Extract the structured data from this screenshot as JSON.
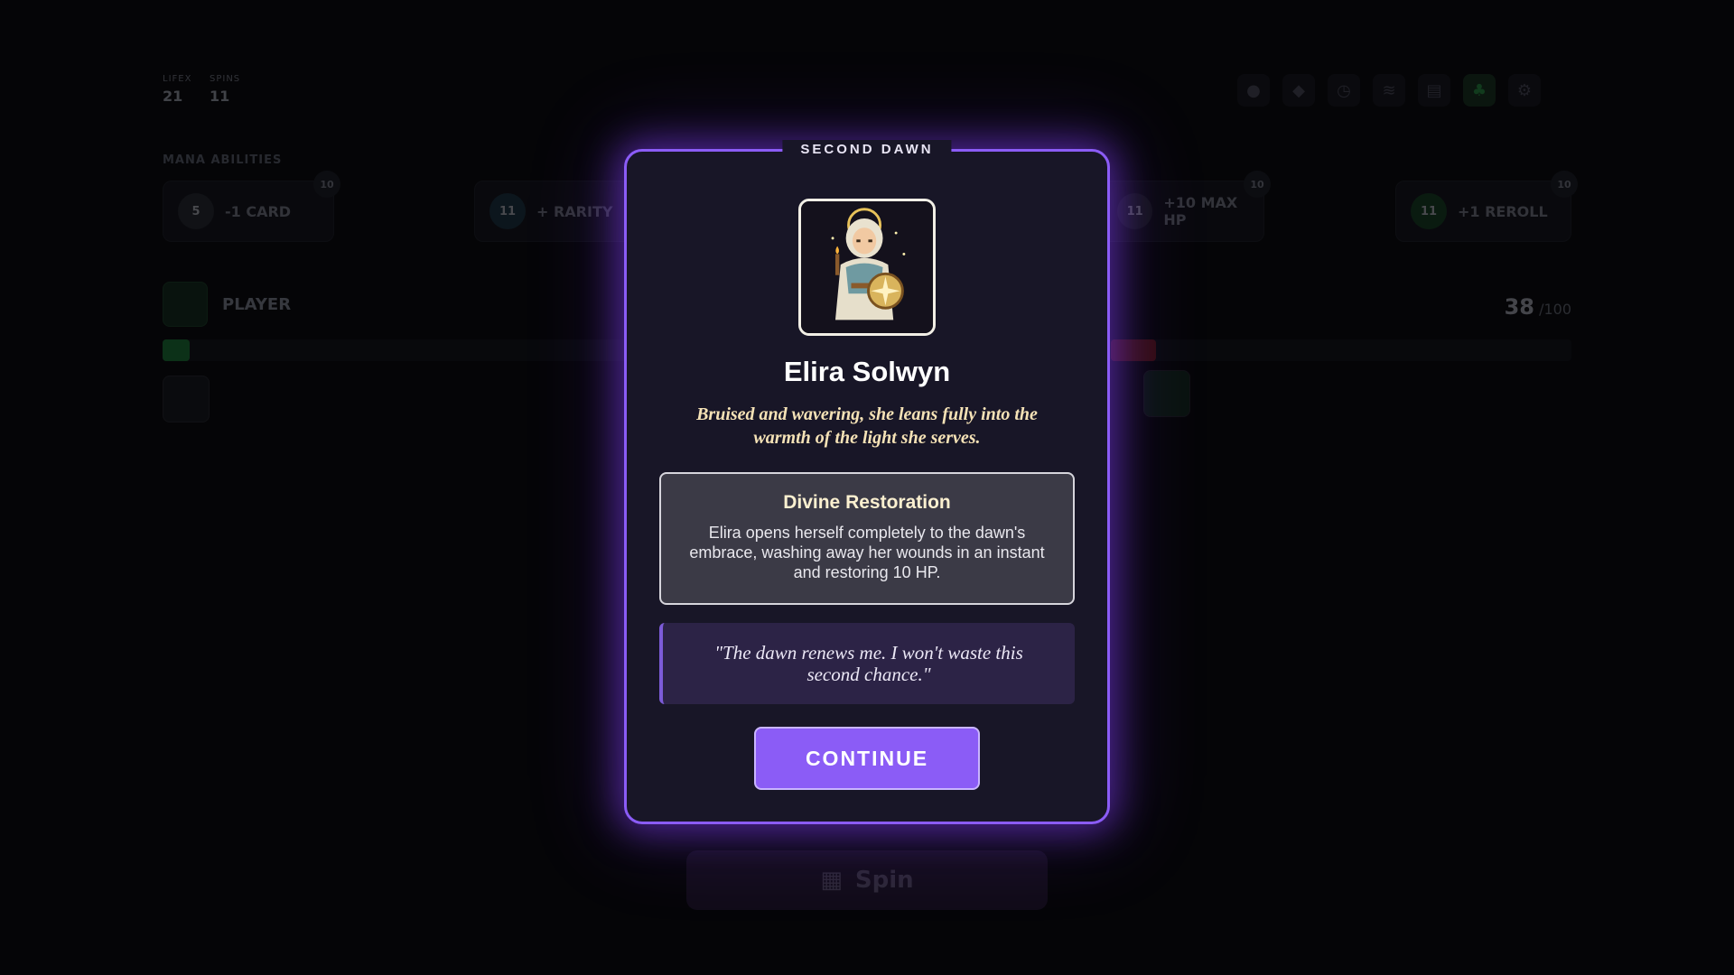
{
  "background": {
    "stats": [
      {
        "label": "LIFEX",
        "value": "21"
      },
      {
        "label": "SPINS",
        "value": "11"
      }
    ],
    "top_icons": [
      "coin-icon",
      "gem-icon",
      "clock-icon",
      "layers-icon",
      "scroll-icon",
      "tree-icon",
      "gear-icon"
    ],
    "mana_title": "MANA ABILITIES",
    "abilities": [
      {
        "label": "-1 CARD",
        "orb": "5",
        "cost": "10",
        "color": "#2a2d36"
      },
      {
        "label": "+ RARITY",
        "orb": "11",
        "cost": "",
        "color": "#1d3a4a"
      },
      {
        "label": "+10 MAX HP",
        "orb": "11",
        "cost": "10",
        "color": "#2a2d36"
      },
      {
        "label": "+1 REROLL",
        "orb": "11",
        "cost": "10",
        "color": "#174a25"
      }
    ],
    "player_label": "PLAYER",
    "hp_current": "38",
    "hp_max": "/100",
    "spin_label": "Spin"
  },
  "modal": {
    "header": "SECOND DAWN",
    "character_name": "Elira Solwyn",
    "description": "Bruised and wavering, she leans fully into the warmth of the light she serves.",
    "ability_title": "Divine Restoration",
    "ability_text": "Elira opens herself completely to the dawn's embrace, washing away her wounds in an instant and restoring 10 HP.",
    "quote": "\"The dawn renews me. I won't waste this second chance.\"",
    "continue_label": "CONTINUE"
  },
  "colors": {
    "accent": "#8b5cf6",
    "modal_bg": "#181627",
    "description_text": "#f5e2b6"
  }
}
